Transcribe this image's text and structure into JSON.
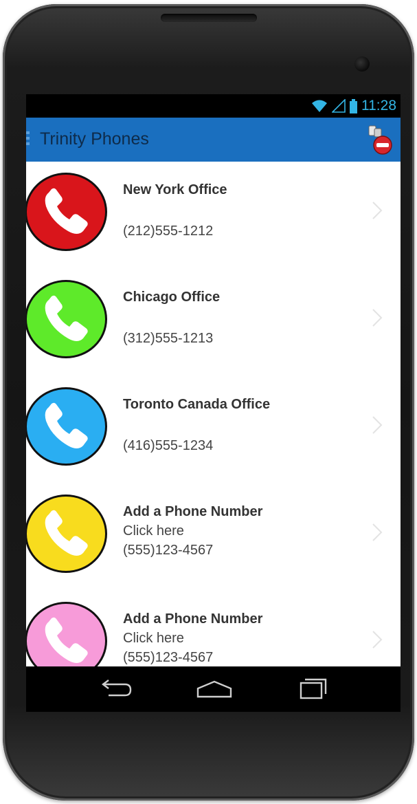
{
  "status_bar": {
    "time": "11:28",
    "icons": [
      "wifi-icon",
      "signal-icon",
      "battery-icon"
    ]
  },
  "action_bar": {
    "title": "Trinity Phones",
    "icon": "app-badge-icon",
    "color": "#1a6fbf"
  },
  "contacts": [
    {
      "title": "New York Office",
      "line1": "",
      "line2": "(212)555-1212",
      "color": "#d9151b"
    },
    {
      "title": "Chicago Office",
      "line1": "",
      "line2": "(312)555-1213",
      "color": "#5eea2a"
    },
    {
      "title": "Toronto Canada Office",
      "line1": "",
      "line2": "(416)555-1234",
      "color": "#2aaef2"
    },
    {
      "title": "Add a Phone Number",
      "line1": "Click here",
      "line2": "(555)123-4567",
      "color": "#f8dc1e"
    },
    {
      "title": "Add a Phone Number",
      "line1": "Click here",
      "line2": "(555)123-4567",
      "color": "#f79bd9"
    }
  ],
  "nav_bar": {
    "buttons": [
      "back-icon",
      "home-icon",
      "recents-icon"
    ]
  }
}
